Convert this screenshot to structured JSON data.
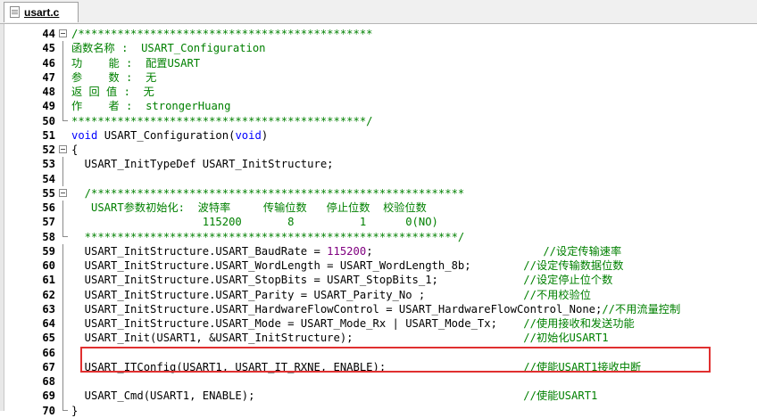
{
  "tab": {
    "label": "usart.c"
  },
  "lines": [
    {
      "n": "44",
      "segs": [
        {
          "t": "/*********************************************",
          "c": "green"
        }
      ]
    },
    {
      "n": "45",
      "segs": [
        {
          "t": "函数名称 :  USART_Configuration",
          "c": "green"
        }
      ]
    },
    {
      "n": "46",
      "segs": [
        {
          "t": "功    能 :  配置USART",
          "c": "green"
        }
      ]
    },
    {
      "n": "47",
      "segs": [
        {
          "t": "参    数 :  无",
          "c": "green"
        }
      ]
    },
    {
      "n": "48",
      "segs": [
        {
          "t": "返 回 值 :  无",
          "c": "green"
        }
      ]
    },
    {
      "n": "49",
      "segs": [
        {
          "t": "作    者 :  strongerHuang",
          "c": "green"
        }
      ]
    },
    {
      "n": "50",
      "segs": [
        {
          "t": "*********************************************/",
          "c": "green"
        }
      ]
    },
    {
      "n": "51",
      "segs": [
        {
          "t": "void",
          "c": "blue"
        },
        {
          "t": " USART_Configuration(",
          "c": "black"
        },
        {
          "t": "void",
          "c": "blue"
        },
        {
          "t": ")",
          "c": "black"
        }
      ]
    },
    {
      "n": "52",
      "segs": [
        {
          "t": "{",
          "c": "black"
        }
      ]
    },
    {
      "n": "53",
      "segs": [
        {
          "t": "  USART_InitTypeDef USART_InitStructure;",
          "c": "black"
        }
      ]
    },
    {
      "n": "54",
      "segs": [
        {
          "t": "",
          "c": "black"
        }
      ]
    },
    {
      "n": "55",
      "segs": [
        {
          "t": "  /*********************************************************",
          "c": "green"
        }
      ]
    },
    {
      "n": "56",
      "segs": [
        {
          "t": "   USART参数初始化:  波特率     传输位数   停止位数  校验位数",
          "c": "green"
        }
      ]
    },
    {
      "n": "57",
      "segs": [
        {
          "t": "                    115200       8          1      0(NO)",
          "c": "green"
        }
      ]
    },
    {
      "n": "58",
      "segs": [
        {
          "t": "  *********************************************************/",
          "c": "green"
        }
      ]
    },
    {
      "n": "59",
      "segs": [
        {
          "t": "  USART_InitStructure.USART_BaudRate = ",
          "c": "black"
        },
        {
          "t": "115200",
          "c": "purple"
        },
        {
          "t": ";                          ",
          "c": "black"
        },
        {
          "t": "//设定传输速率",
          "c": "green"
        }
      ]
    },
    {
      "n": "60",
      "segs": [
        {
          "t": "  USART_InitStructure.USART_WordLength = USART_WordLength_8b;        ",
          "c": "black"
        },
        {
          "t": "//设定传输数据位数",
          "c": "green"
        }
      ]
    },
    {
      "n": "61",
      "segs": [
        {
          "t": "  USART_InitStructure.USART_StopBits = USART_StopBits_1;             ",
          "c": "black"
        },
        {
          "t": "//设定停止位个数",
          "c": "green"
        }
      ]
    },
    {
      "n": "62",
      "segs": [
        {
          "t": "  USART_InitStructure.USART_Parity = USART_Parity_No ;               ",
          "c": "black"
        },
        {
          "t": "//不用校验位",
          "c": "green"
        }
      ]
    },
    {
      "n": "63",
      "segs": [
        {
          "t": "  USART_InitStructure.USART_HardwareFlowControl = USART_HardwareFlowControl_None;",
          "c": "black"
        },
        {
          "t": "//不用流量控制",
          "c": "green"
        }
      ]
    },
    {
      "n": "64",
      "segs": [
        {
          "t": "  USART_InitStructure.USART_Mode = USART_Mode_Rx | USART_Mode_Tx;    ",
          "c": "black"
        },
        {
          "t": "//使用接收和发送功能",
          "c": "green"
        }
      ]
    },
    {
      "n": "65",
      "segs": [
        {
          "t": "  USART_Init(USART1, &USART_InitStructure);                          ",
          "c": "black"
        },
        {
          "t": "//初始化USART1",
          "c": "green"
        }
      ]
    },
    {
      "n": "66",
      "segs": [
        {
          "t": "",
          "c": "black"
        }
      ]
    },
    {
      "n": "67",
      "segs": [
        {
          "t": "  USART_ITConfig(USART1, USART_IT_RXNE, ENABLE);                     ",
          "c": "black"
        },
        {
          "t": "//使能USART1接收中断",
          "c": "green"
        }
      ]
    },
    {
      "n": "68",
      "segs": [
        {
          "t": "",
          "c": "black"
        }
      ]
    },
    {
      "n": "69",
      "segs": [
        {
          "t": "  USART_Cmd(USART1, ENABLE);                                         ",
          "c": "black"
        },
        {
          "t": "//使能USART1",
          "c": "green"
        }
      ]
    },
    {
      "n": "70",
      "segs": [
        {
          "t": "}",
          "c": "black"
        }
      ]
    }
  ],
  "colors": {
    "highlight_box": "#e03030",
    "comment": "#008000",
    "keyword": "#0000ff",
    "number": "#800080"
  }
}
